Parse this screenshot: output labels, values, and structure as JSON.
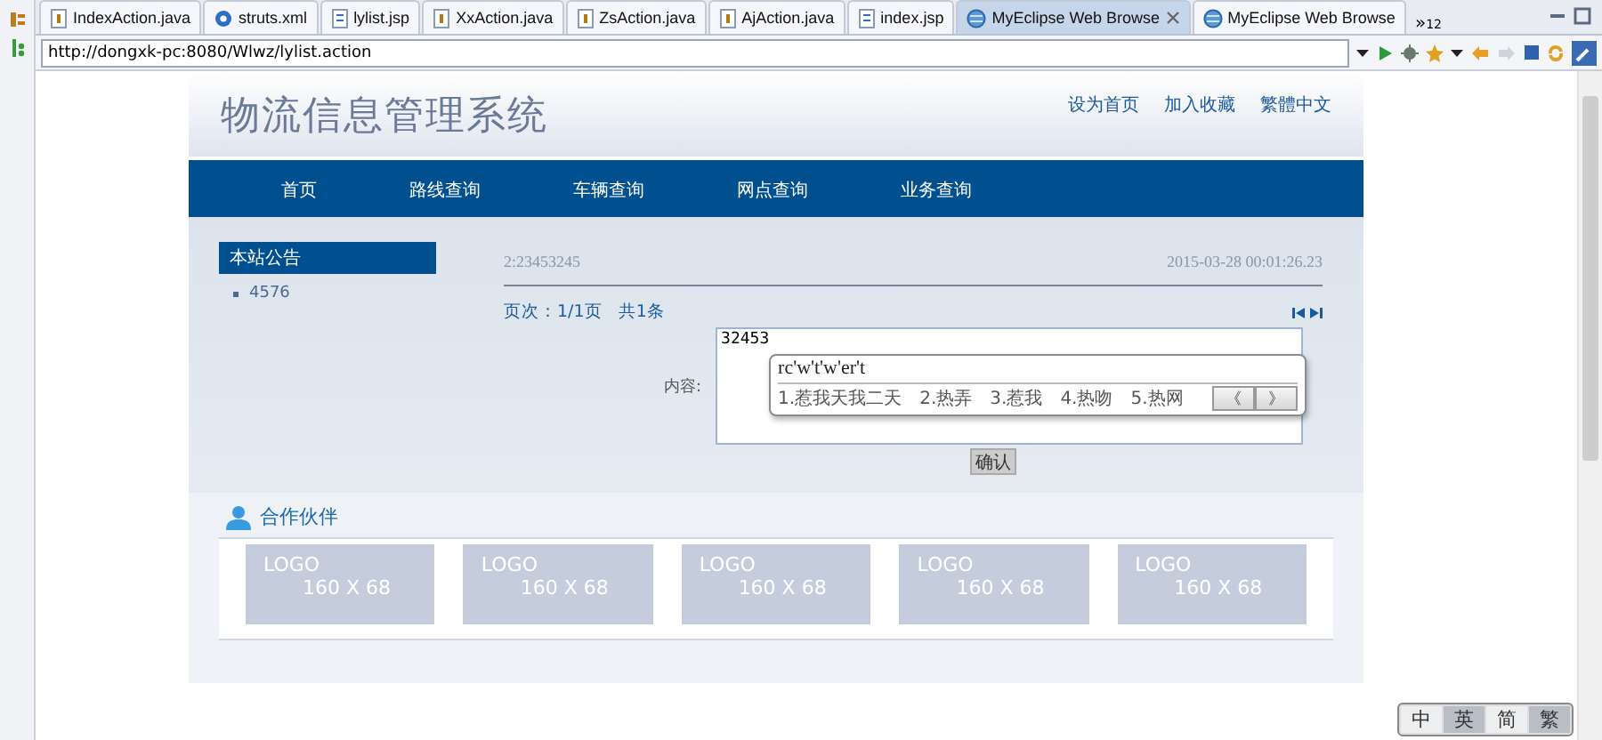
{
  "editor_tabs": [
    {
      "label": "IndexAction.java",
      "kind": "java",
      "selected": false
    },
    {
      "label": "struts.xml",
      "kind": "xml",
      "selected": false
    },
    {
      "label": "lylist.jsp",
      "kind": "jsp",
      "selected": false
    },
    {
      "label": "XxAction.java",
      "kind": "java",
      "selected": false
    },
    {
      "label": "ZsAction.java",
      "kind": "java",
      "selected": false
    },
    {
      "label": "AjAction.java",
      "kind": "java",
      "selected": false
    },
    {
      "label": "index.jsp",
      "kind": "jsp",
      "selected": false
    },
    {
      "label": "MyEclipse Web Browse",
      "kind": "browser",
      "selected": true
    },
    {
      "label": "MyEclipse Web Browse",
      "kind": "browser",
      "selected": false
    }
  ],
  "tab_overflow": {
    "mark": "»",
    "count": "12"
  },
  "address_bar": {
    "value": "http://dongxk-pc:8080/Wlwz/lylist.action"
  },
  "site": {
    "title": "物流信息管理系统",
    "top_links": [
      "设为首页",
      "加入收藏",
      "繁體中文"
    ],
    "nav": [
      "首页",
      "路线查询",
      "车辆查询",
      "网点查询",
      "业务查询"
    ]
  },
  "sidebar": {
    "heading": "本站公告",
    "items": [
      "4576"
    ]
  },
  "message": {
    "author": "2:23453245",
    "time": "2015-03-28 00:01:26.23"
  },
  "pager": {
    "text": "页次：1/1页   共1条"
  },
  "form": {
    "label": "内容:",
    "value": "32453",
    "submit": "确认"
  },
  "ime_popup": {
    "composition": "rc'w't'w'er't",
    "candidates": [
      "1.惹我天我二天",
      "2.热弄",
      "3.惹我",
      "4.热吻",
      "5.热网"
    ],
    "prev": "《",
    "next": "》"
  },
  "partners": {
    "title": "合作伙伴",
    "logos": [
      {
        "name": "LOGO",
        "size": "160 X 68"
      },
      {
        "name": "LOGO",
        "size": "160 X 68"
      },
      {
        "name": "LOGO",
        "size": "160 X 68"
      },
      {
        "name": "LOGO",
        "size": "160 X 68"
      },
      {
        "name": "LOGO",
        "size": "160 X 68"
      }
    ]
  },
  "ime_toolbar": [
    {
      "label": "中",
      "selected": false
    },
    {
      "label": "英",
      "selected": true
    },
    {
      "label": "简",
      "selected": false
    },
    {
      "label": "繁",
      "selected": true
    }
  ]
}
